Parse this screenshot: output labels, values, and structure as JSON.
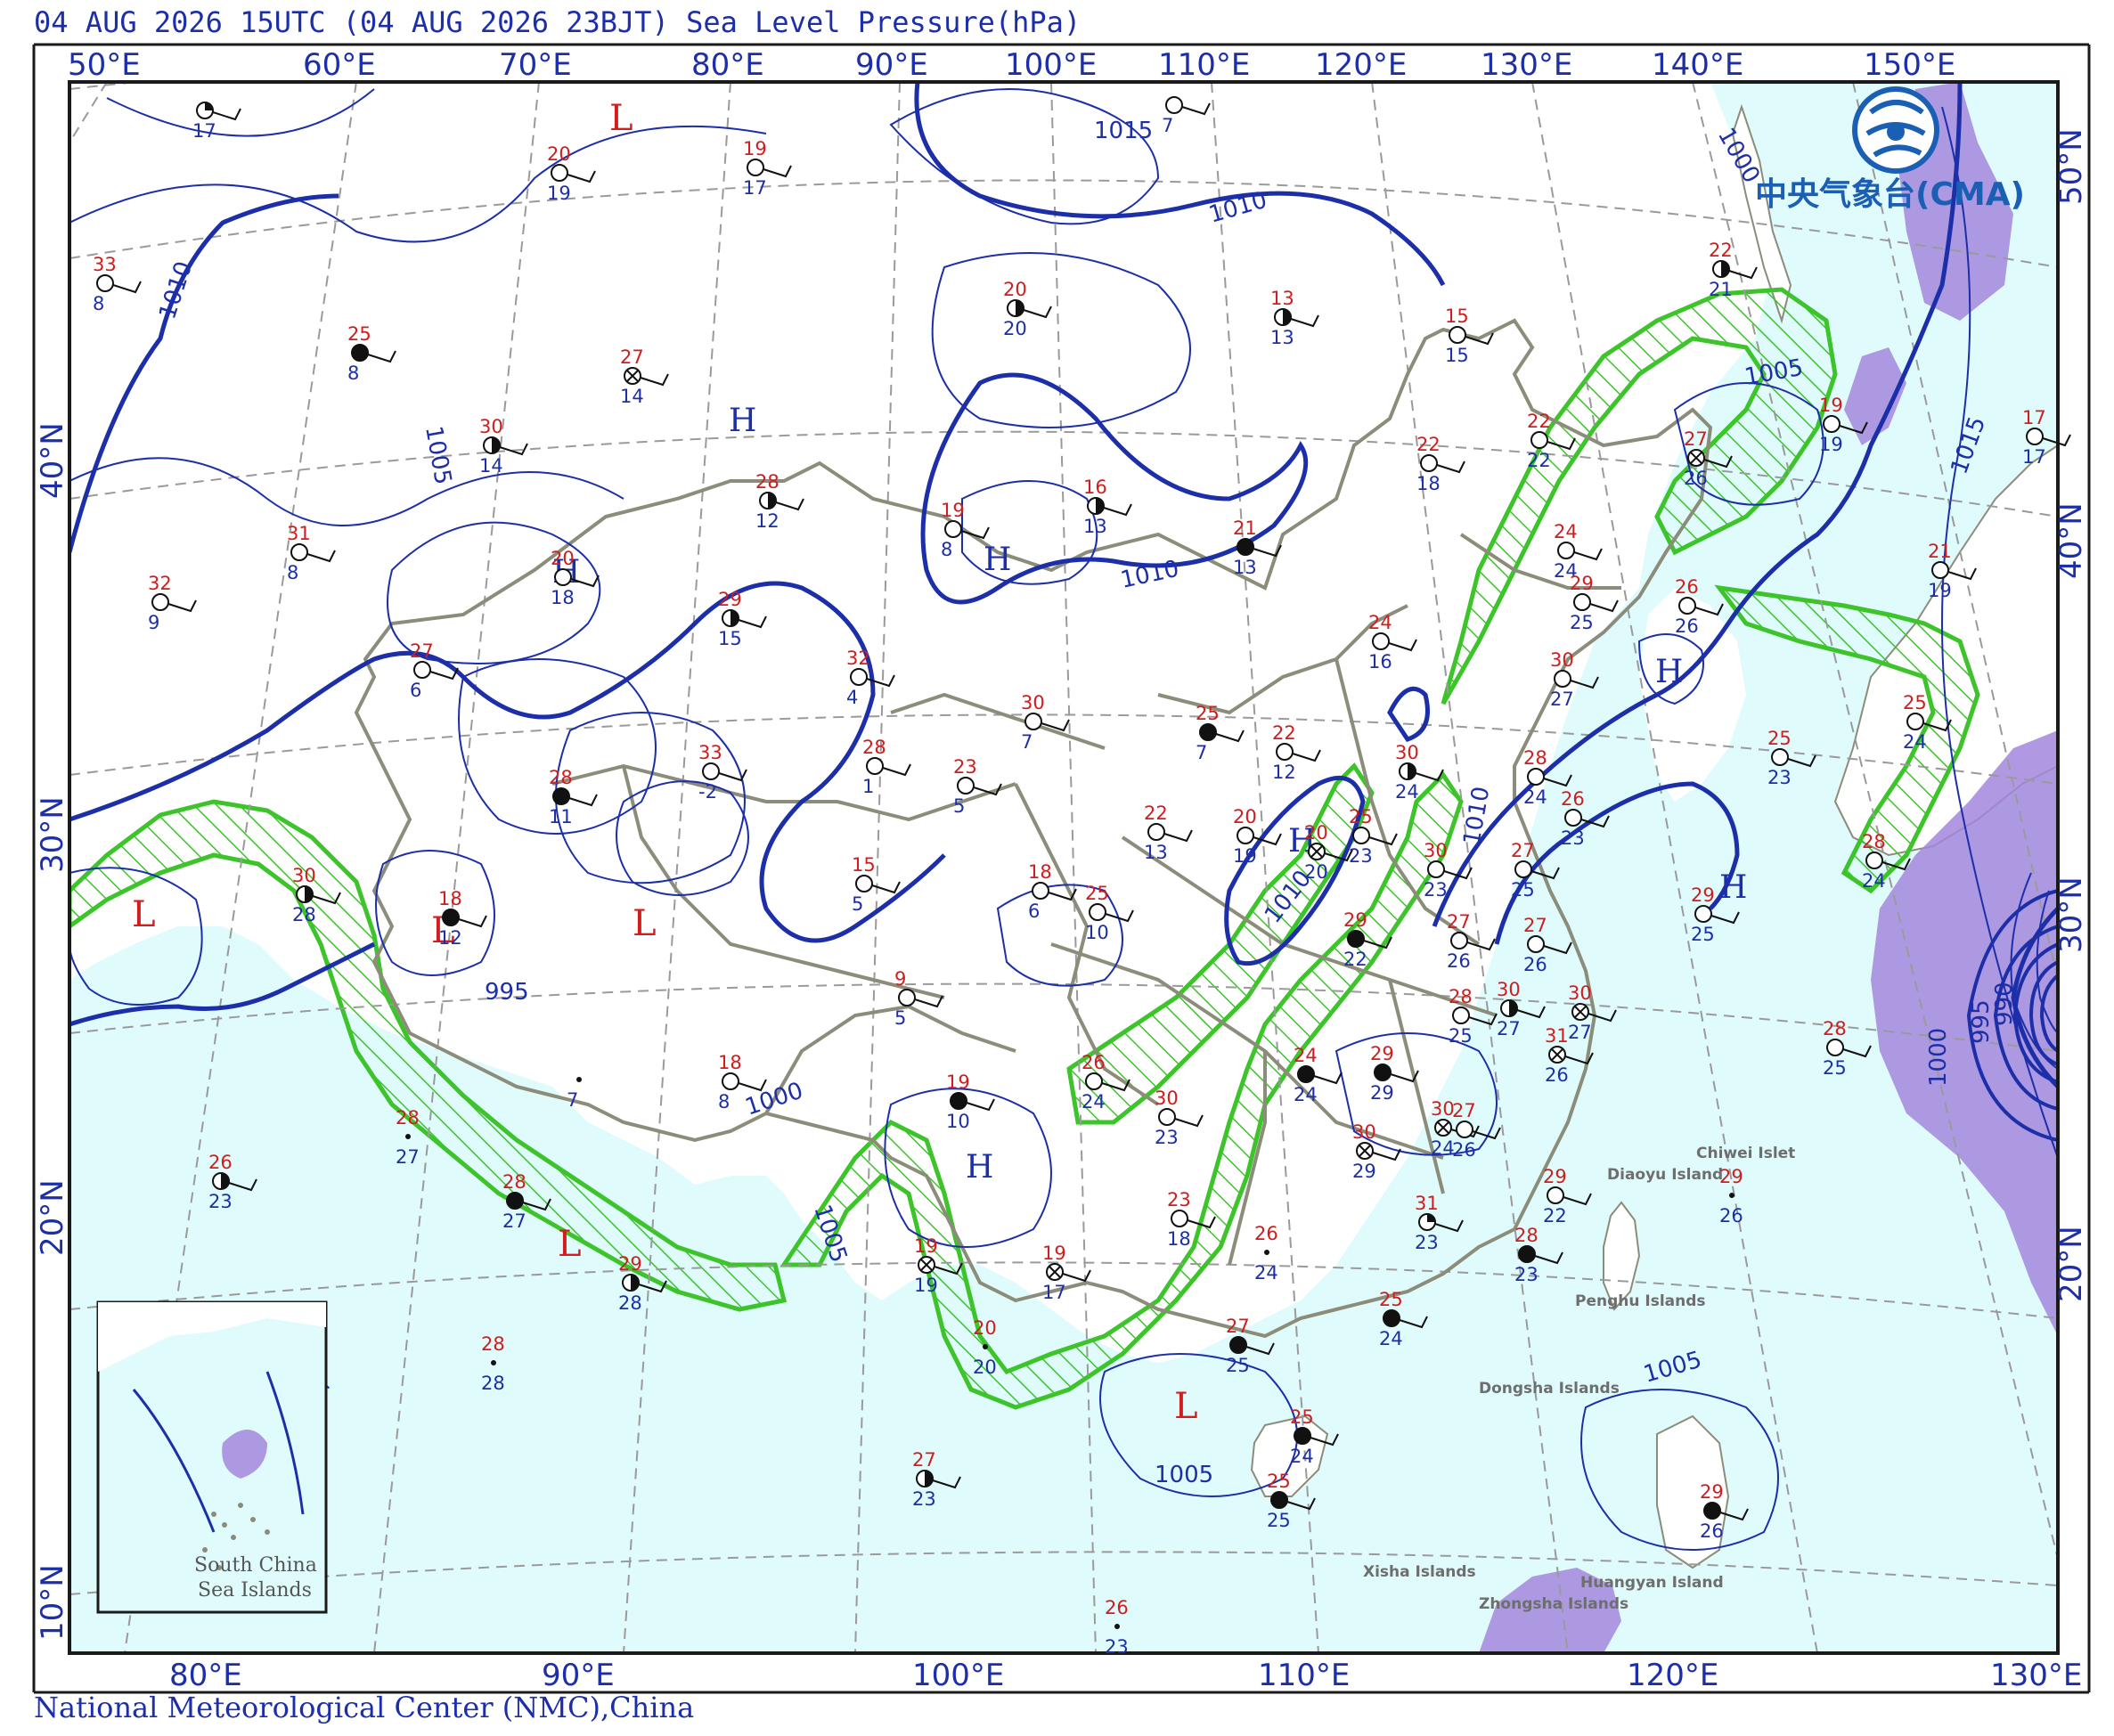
{
  "header": {
    "title": "04 AUG 2026 15UTC (04 AUG 2026 23BJT) Sea Level Pressure(hPa)"
  },
  "footer": {
    "credit": "National Meteorological Center (NMC),China"
  },
  "logo": {
    "name": "中央气象台(CMA)",
    "icon": "cma-logo-icon"
  },
  "colors": {
    "ocean": "#e0fbfc",
    "land": "#ffffff",
    "isobar": "#1d2fa8",
    "boundary": "#8c8c7a",
    "graticule": "#9a9a9a",
    "rain": "#3cc42a",
    "purple": "#a386dd",
    "temp": "#d11d1d",
    "dew": "#1d2fa8"
  },
  "axes": {
    "top": [
      "50°E",
      "60°E",
      "70°E",
      "80°E",
      "90°E",
      "100°E",
      "110°E",
      "120°E",
      "130°E",
      "140°E",
      "150°E"
    ],
    "bottom": [
      "80°E",
      "90°E",
      "100°E",
      "110°E",
      "120°E",
      "130°E"
    ],
    "left": [
      "40°N",
      "30°N",
      "20°N",
      "10°N"
    ],
    "right": [
      "50°N",
      "40°N",
      "30°N",
      "20°N"
    ]
  },
  "isobar_labels": [
    "1015",
    "1010",
    "1010",
    "1005",
    "1010",
    "995",
    "1000",
    "1005",
    "1010",
    "1010",
    "1000",
    "1005",
    "1015",
    "1005",
    "1005",
    "1000",
    "995",
    "990",
    "1005",
    "1010"
  ],
  "centers": {
    "H": [
      "H",
      "H",
      "H",
      "H",
      "H",
      "H",
      "H"
    ],
    "L": [
      "L",
      "L",
      "L",
      "L",
      "L",
      "L",
      "L",
      "L"
    ]
  },
  "places": [
    "Chiwei Islet",
    "Diaoyu Island",
    "Penghu Islands",
    "Dongsha Islands",
    "Xisha Islands",
    "Huangyan Island",
    "Zhongsha Islands"
  ],
  "inset": {
    "label_line1": "South China",
    "label_line2": "Sea Islands"
  },
  "stations": [
    {
      "t": "",
      "d": "17",
      "cover": "quarter"
    },
    {
      "t": "19",
      "d": "17",
      "cover": "clear"
    },
    {
      "t": "20",
      "d": "19",
      "cover": "clear"
    },
    {
      "t": "",
      "d": "7",
      "cover": "clear"
    },
    {
      "t": "33",
      "d": "8",
      "cover": "clear"
    },
    {
      "t": "25",
      "d": "8",
      "cover": "overcast"
    },
    {
      "t": "20",
      "d": "20",
      "cover": "half"
    },
    {
      "t": "13",
      "d": "13",
      "cover": "half"
    },
    {
      "t": "15",
      "d": "15",
      "cover": "clear"
    },
    {
      "t": "22",
      "d": "21",
      "cover": "half"
    },
    {
      "t": "27",
      "d": "14",
      "cover": "obscured"
    },
    {
      "t": "30",
      "d": "14",
      "cover": "half"
    },
    {
      "t": "22",
      "d": "22",
      "cover": "clear"
    },
    {
      "t": "27",
      "d": "26",
      "cover": "obscured"
    },
    {
      "t": "19",
      "d": "19",
      "cover": "clear"
    },
    {
      "t": "17",
      "d": "17",
      "cover": "clear"
    },
    {
      "t": "28",
      "d": "12",
      "cover": "half"
    },
    {
      "t": "16",
      "d": "13",
      "cover": "half"
    },
    {
      "t": "22",
      "d": "18",
      "cover": "clear"
    },
    {
      "t": "31",
      "d": "8",
      "cover": "clear"
    },
    {
      "t": "19",
      "d": "8",
      "cover": "clear"
    },
    {
      "t": "21",
      "d": "13",
      "cover": "overcast"
    },
    {
      "t": "24",
      "d": "24",
      "cover": "clear"
    },
    {
      "t": "32",
      "d": "9",
      "cover": "clear"
    },
    {
      "t": "20",
      "d": "18",
      "cover": "clear"
    },
    {
      "t": "29",
      "d": "15",
      "cover": "half"
    },
    {
      "t": "29",
      "d": "25",
      "cover": "clear"
    },
    {
      "t": "26",
      "d": "26",
      "cover": "clear"
    },
    {
      "t": "21",
      "d": "19",
      "cover": "clear"
    },
    {
      "t": "27",
      "d": "6",
      "cover": "clear"
    },
    {
      "t": "32",
      "d": "4",
      "cover": "clear"
    },
    {
      "t": "24",
      "d": "16",
      "cover": "clear"
    },
    {
      "t": "30",
      "d": "27",
      "cover": "clear"
    },
    {
      "t": "30",
      "d": "7",
      "cover": "clear"
    },
    {
      "t": "25",
      "d": "7",
      "cover": "overcast"
    },
    {
      "t": "22",
      "d": "12",
      "cover": "clear"
    },
    {
      "t": "25",
      "d": "24",
      "cover": "clear"
    },
    {
      "t": "33",
      "d": "-2",
      "cover": "clear"
    },
    {
      "t": "28",
      "d": "1",
      "cover": "clear"
    },
    {
      "t": "23",
      "d": "5",
      "cover": "clear"
    },
    {
      "t": "30",
      "d": "24",
      "cover": "half"
    },
    {
      "t": "28",
      "d": "24",
      "cover": "clear"
    },
    {
      "t": "25",
      "d": "23",
      "cover": "clear"
    },
    {
      "t": "28",
      "d": "11",
      "cover": "overcast"
    },
    {
      "t": "22",
      "d": "13",
      "cover": "clear"
    },
    {
      "t": "20",
      "d": "19",
      "cover": "clear"
    },
    {
      "t": "20",
      "d": "20",
      "cover": "obscured"
    },
    {
      "t": "25",
      "d": "23",
      "cover": "clear"
    },
    {
      "t": "26",
      "d": "23",
      "cover": "clear"
    },
    {
      "t": "30",
      "d": "28",
      "cover": "half"
    },
    {
      "t": "15",
      "d": "5",
      "cover": "clear"
    },
    {
      "t": "18",
      "d": "6",
      "cover": "clear"
    },
    {
      "t": "30",
      "d": "23",
      "cover": "clear"
    },
    {
      "t": "27",
      "d": "25",
      "cover": "clear"
    },
    {
      "t": "28",
      "d": "24",
      "cover": "clear"
    },
    {
      "t": "18",
      "d": "12",
      "cover": "overcast"
    },
    {
      "t": "25",
      "d": "10",
      "cover": "clear"
    },
    {
      "t": "29",
      "d": "22",
      "cover": "overcast"
    },
    {
      "t": "27",
      "d": "26",
      "cover": "clear"
    },
    {
      "t": "27",
      "d": "26",
      "cover": "clear"
    },
    {
      "t": "29",
      "d": "25",
      "cover": "clear"
    },
    {
      "t": "9",
      "d": "5",
      "cover": "clear"
    },
    {
      "t": "28",
      "d": "25",
      "cover": "clear"
    },
    {
      "t": "30",
      "d": "27",
      "cover": "half"
    },
    {
      "t": "30",
      "d": "27",
      "cover": "obscured"
    },
    {
      "t": "",
      "d": "7",
      "cover": "none"
    },
    {
      "t": "18",
      "d": "8",
      "cover": "clear"
    },
    {
      "t": "26",
      "d": "24",
      "cover": "clear"
    },
    {
      "t": "24",
      "d": "24",
      "cover": "overcast"
    },
    {
      "t": "29",
      "d": "29",
      "cover": "overcast"
    },
    {
      "t": "31",
      "d": "26",
      "cover": "obscured"
    },
    {
      "t": "28",
      "d": "25",
      "cover": "clear"
    },
    {
      "t": "28",
      "d": "27",
      "cover": "none"
    },
    {
      "t": "19",
      "d": "10",
      "cover": "overcast"
    },
    {
      "t": "30",
      "d": "23",
      "cover": "clear"
    },
    {
      "t": "30",
      "d": "29",
      "cover": "obscured"
    },
    {
      "t": "30",
      "d": "24",
      "cover": "obscured"
    },
    {
      "t": "27",
      "d": "26",
      "cover": "clear"
    },
    {
      "t": "26",
      "d": "23",
      "cover": "half"
    },
    {
      "t": "23",
      "d": "18",
      "cover": "clear"
    },
    {
      "t": "31",
      "d": "23",
      "cover": "quarter"
    },
    {
      "t": "29",
      "d": "22",
      "cover": "clear"
    },
    {
      "t": "29",
      "d": "26",
      "cover": "none"
    },
    {
      "t": "28",
      "d": "27",
      "cover": "overcast"
    },
    {
      "t": "26",
      "d": "24",
      "cover": "none"
    },
    {
      "t": "28",
      "d": "23",
      "cover": "overcast"
    },
    {
      "t": "29",
      "d": "28",
      "cover": "half"
    },
    {
      "t": "19",
      "d": "19",
      "cover": "obscured"
    },
    {
      "t": "19",
      "d": "17",
      "cover": "obscured"
    },
    {
      "t": "20",
      "d": "20",
      "cover": "none"
    },
    {
      "t": "25",
      "d": "24",
      "cover": "overcast"
    },
    {
      "t": "28",
      "d": "28",
      "cover": "none"
    },
    {
      "t": "27",
      "d": "25",
      "cover": "overcast"
    },
    {
      "t": "25",
      "d": "24",
      "cover": "overcast"
    },
    {
      "t": "27",
      "d": "23",
      "cover": "half"
    },
    {
      "t": "25",
      "d": "25",
      "cover": "overcast"
    },
    {
      "t": "29",
      "d": "26",
      "cover": "overcast"
    },
    {
      "t": "26",
      "d": "23",
      "cover": "none"
    }
  ]
}
